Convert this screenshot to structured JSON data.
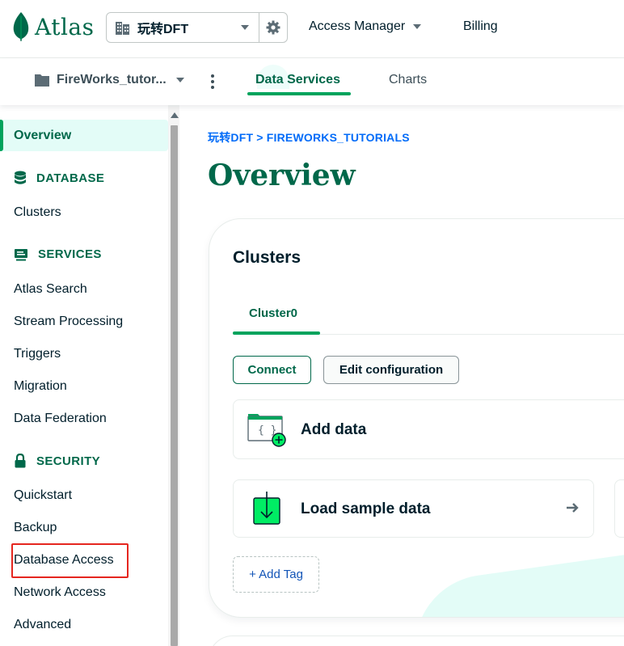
{
  "app": {
    "logo_text": "Atlas"
  },
  "topbar": {
    "org": "玩转DFT",
    "nav": [
      "Access Manager",
      "Billing"
    ]
  },
  "projectbar": {
    "project": "FireWorks_tutor...",
    "tabs": [
      "Data Services",
      "Charts"
    ],
    "active_tab": "Data Services"
  },
  "sidebar": {
    "overview": "Overview",
    "sections": {
      "database": {
        "label": "DATABASE",
        "items": [
          "Clusters"
        ]
      },
      "services": {
        "label": "SERVICES",
        "items": [
          "Atlas Search",
          "Stream Processing",
          "Triggers",
          "Migration",
          "Data Federation"
        ]
      },
      "security": {
        "label": "SECURITY",
        "items": [
          "Quickstart",
          "Backup",
          "Database Access",
          "Network Access",
          "Advanced"
        ]
      }
    },
    "highlighted_item": "Database Access"
  },
  "main": {
    "breadcrumb": "玩转DFT > FIREWORKS_TUTORIALS",
    "title": "Overview",
    "clusters_card": {
      "title": "Clusters",
      "tab": "Cluster0",
      "connect_label": "Connect",
      "edit_label": "Edit configuration",
      "add_data_label": "Add data",
      "load_sample_label": "Load sample data",
      "add_tag_label": "+ Add Tag"
    }
  },
  "colors": {
    "brand_green": "#00684a",
    "accent_green": "#00a35c",
    "link_blue": "#016bf8",
    "highlight_red": "#e5261f"
  }
}
